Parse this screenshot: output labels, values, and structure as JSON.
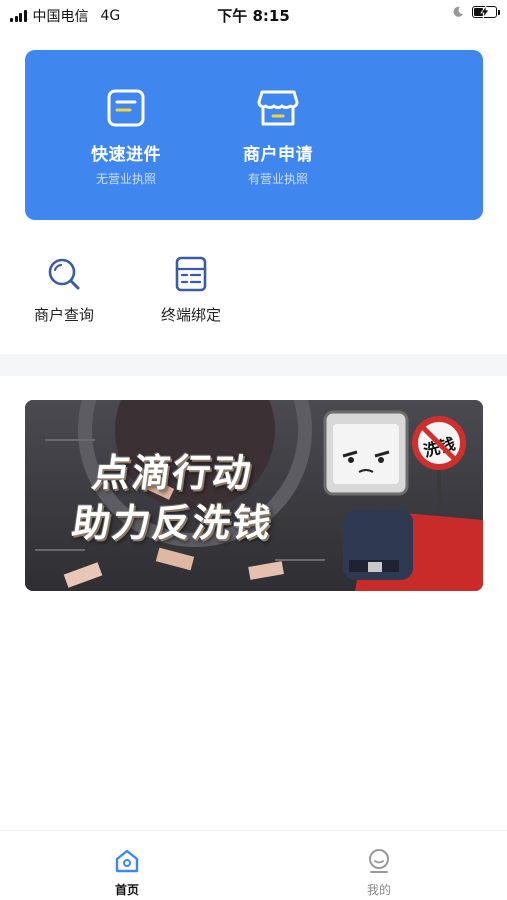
{
  "status_bar": {
    "carrier": "中国电信",
    "network": "4G",
    "time": "下午 8:15"
  },
  "primary_actions": [
    {
      "title": "快速进件",
      "subtitle": "无营业执照",
      "icon": "document-icon"
    },
    {
      "title": "商户申请",
      "subtitle": "有营业执照",
      "icon": "storefront-icon"
    }
  ],
  "secondary_actions": [
    {
      "label": "商户查询",
      "icon": "search-icon"
    },
    {
      "label": "终端绑定",
      "icon": "calculator-icon"
    }
  ],
  "banner": {
    "line1": "点滴行动",
    "line2": "助力反洗钱",
    "sign_text": "洗钱"
  },
  "tabbar": {
    "items": [
      {
        "label": "首页",
        "icon": "home-icon",
        "active": true
      },
      {
        "label": "我的",
        "icon": "profile-icon",
        "active": false
      }
    ]
  },
  "colors": {
    "primary": "#3f86ef",
    "accent_yellow": "#f5d33b",
    "icon_blue": "#3b5aa8"
  }
}
